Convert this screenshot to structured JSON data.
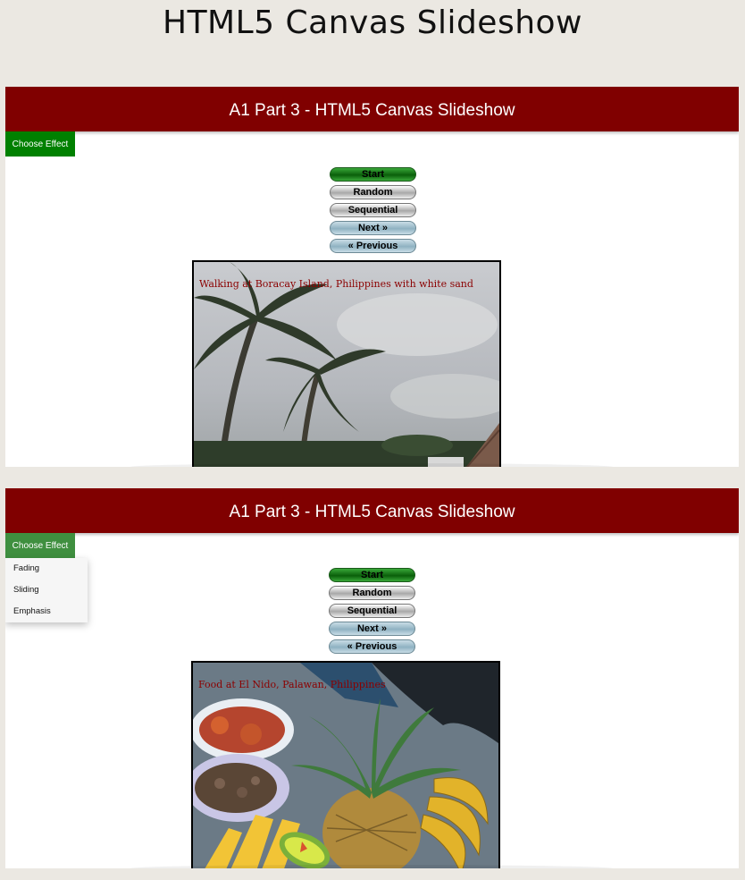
{
  "page": {
    "title": "HTML5 Canvas Slideshow"
  },
  "panels": [
    {
      "banner": "A1 Part 3 - HTML5 Canvas Slideshow",
      "effect_button": "Choose Effect",
      "buttons": {
        "start": "Start",
        "random": "Random",
        "sequential": "Sequential",
        "next": "Next »",
        "previous": "« Previous"
      },
      "slide_caption": "Walking at Boracay Island, Philippines with white sand"
    },
    {
      "banner": "A1 Part 3 - HTML5 Canvas Slideshow",
      "effect_button": "Choose Effect",
      "effect_options": [
        "Fading",
        "Sliding",
        "Emphasis"
      ],
      "buttons": {
        "start": "Start",
        "random": "Random",
        "sequential": "Sequential",
        "next": "Next »",
        "previous": "« Previous"
      },
      "slide_caption": "Food at El Nido, Palawan, Philippines"
    }
  ],
  "colors": {
    "background": "#ebe8e2",
    "banner": "#800000",
    "effect_button": "#008000",
    "caption": "#8b0000"
  }
}
